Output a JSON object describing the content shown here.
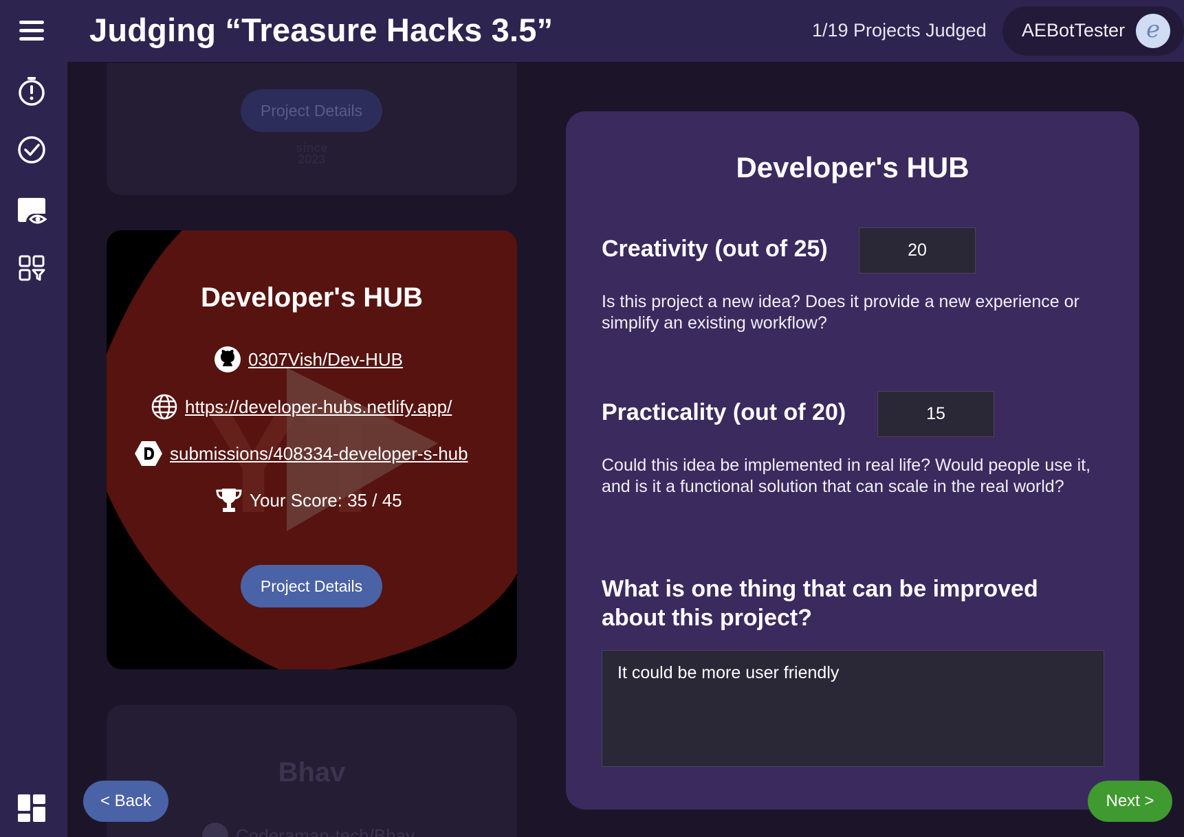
{
  "header": {
    "title": "Judging “Treasure Hacks 3.5”",
    "progress": "1/19 Projects Judged",
    "user_name": "AEBotTester",
    "avatar_letter": "e"
  },
  "sidebar": {
    "icons": [
      "menu-icon",
      "timer-icon",
      "check-circle-icon",
      "preview-eye-icon",
      "apps-filter-icon",
      "dashboard-icon"
    ]
  },
  "cards": {
    "previous": {
      "details_label": "Project Details",
      "since_line1": "since",
      "since_line2": "2023"
    },
    "current": {
      "title": "Developer's HUB",
      "github": "0307Vish/Dev-HUB",
      "website": "https://developer-hubs.netlify.app/",
      "devpost": "submissions/408334-developer-s-hub",
      "score": "Your Score: 35 / 45",
      "details_label": "Project Details"
    },
    "next": {
      "title": "Bhav",
      "github": "Coderaman-tech/Bhav"
    }
  },
  "panel": {
    "title": "Developer's HUB",
    "creativity": {
      "label": "Creativity (out of 25)",
      "value": "20",
      "description": "Is this project a new idea? Does it provide a new experience or simplify an existing workflow?"
    },
    "practicality": {
      "label": "Practicality (out of 20)",
      "value": "15",
      "description": "Could this idea be implemented in real life? Would people use it, and is it a functional solution that can scale in the real world?"
    },
    "improve": {
      "label": "What is one thing that can be improved about this project?",
      "value": "It could be more user friendly"
    }
  },
  "nav": {
    "back_label": "< Back",
    "next_label": "Next >"
  },
  "colors": {
    "background": "#1c1529",
    "header": "#2e2450",
    "panel": "#3b2a5e",
    "primary_button": "#4a62a6",
    "next_button": "#3f9a2f"
  }
}
